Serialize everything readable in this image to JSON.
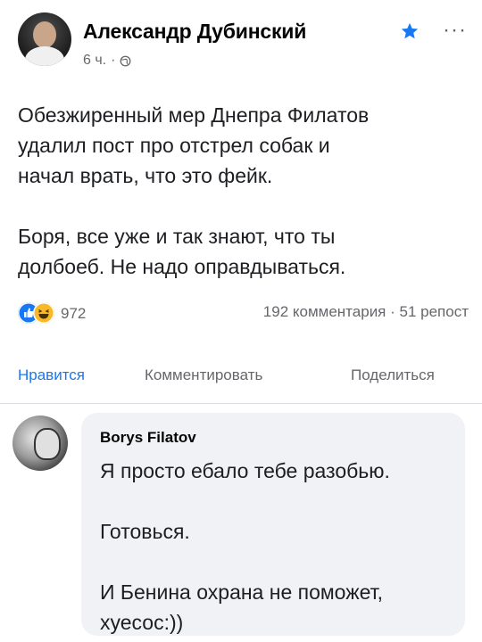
{
  "post": {
    "author": "Александр Дубинский",
    "time": "6 ч.",
    "separator": "·",
    "body_lines": [
      "Обезжиренный мер Днепра Филатов",
      "удалил пост про отстрел собак и",
      "начал врать, что это фейк.",
      "Боря, все уже и так знают, что ты",
      "долбоеб. Не надо оправдываться."
    ],
    "reaction_count": "972",
    "comments_shares": "192 комментария · 51 репост"
  },
  "actions": {
    "like": "Нравится",
    "comment": "Комментировать",
    "share": "Поделиться"
  },
  "comment": {
    "author": "Borys Filatov",
    "lines": [
      "Я просто ебало тебе разобью.",
      "Готовься.",
      "И Бенина охрана не поможет,",
      "хуесос:))"
    ]
  },
  "icons": {
    "globe": "globe-icon",
    "star": "star-icon",
    "more": "more-icon",
    "like_reaction": "like-reaction-icon",
    "haha_reaction": "haha-reaction-icon"
  },
  "colors": {
    "accent": "#1877f2",
    "muted": "#65676b",
    "bubble": "#f0f2f5",
    "star": "#1877f2"
  }
}
